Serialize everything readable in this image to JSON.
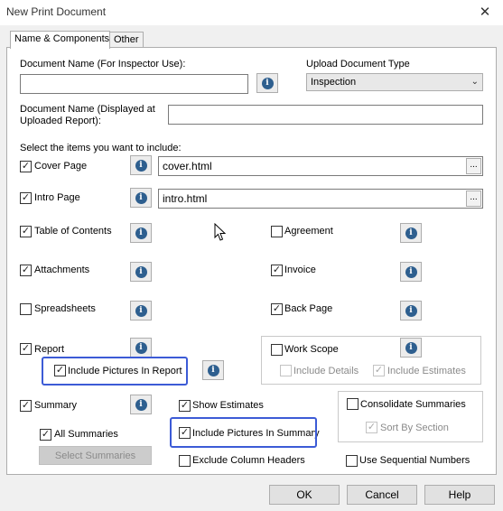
{
  "window": {
    "title": "New Print Document",
    "close_glyph": "✕"
  },
  "tabs": [
    {
      "label": "Name & Components",
      "active": true
    },
    {
      "label": "Other",
      "active": false
    }
  ],
  "form": {
    "doc_name_inspector_label": "Document Name (For Inspector Use):",
    "doc_name_inspector_value": "",
    "upload_type_label": "Upload Document Type",
    "upload_type_value": "Inspection",
    "doc_name_report_label_line1": "Document Name (Displayed at",
    "doc_name_report_label_line2": "Uploaded Report):",
    "doc_name_report_value": "",
    "select_items_label": "Select the items you want to include:"
  },
  "items": {
    "cover_page": {
      "label": "Cover Page",
      "checked": true,
      "file": "cover.html"
    },
    "intro_page": {
      "label": "Intro Page",
      "checked": true,
      "file": "intro.html"
    },
    "table_of_contents": {
      "label": "Table of Contents",
      "checked": true
    },
    "agreement": {
      "label": "Agreement",
      "checked": false
    },
    "attachments": {
      "label": "Attachments",
      "checked": true
    },
    "invoice": {
      "label": "Invoice",
      "checked": true
    },
    "spreadsheets": {
      "label": "Spreadsheets",
      "checked": false
    },
    "back_page": {
      "label": "Back Page",
      "checked": true
    },
    "report": {
      "label": "Report",
      "checked": true
    },
    "include_pictures_report": {
      "label": "Include Pictures In Report",
      "checked": true
    },
    "work_scope": {
      "label": "Work Scope",
      "checked": false
    },
    "include_details": {
      "label": "Include Details",
      "checked": false
    },
    "include_estimates": {
      "label": "Include Estimates",
      "checked": true
    },
    "summary": {
      "label": "Summary",
      "checked": true
    },
    "all_summaries": {
      "label": "All Summaries",
      "checked": true
    },
    "select_summaries_button": "Select Summaries",
    "show_estimates": {
      "label": "Show Estimates",
      "checked": true
    },
    "include_pictures_summary": {
      "label": "Include Pictures In Summary",
      "checked": true
    },
    "exclude_column_headers": {
      "label": "Exclude Column Headers",
      "checked": false
    },
    "consolidate_summaries": {
      "label": "Consolidate Summaries",
      "checked": false
    },
    "sort_by_section": {
      "label": "Sort By Section",
      "checked": true
    },
    "use_sequential_numbers": {
      "label": "Use Sequential Numbers",
      "checked": false
    }
  },
  "glyphs": {
    "check": "✓",
    "info": "i",
    "browse": "...",
    "chevron": "⌄"
  },
  "buttons": {
    "ok": "OK",
    "cancel": "Cancel",
    "help": "Help"
  },
  "colors": {
    "highlight": "#3c5bd6",
    "info_icon": "#2e5f8f"
  }
}
